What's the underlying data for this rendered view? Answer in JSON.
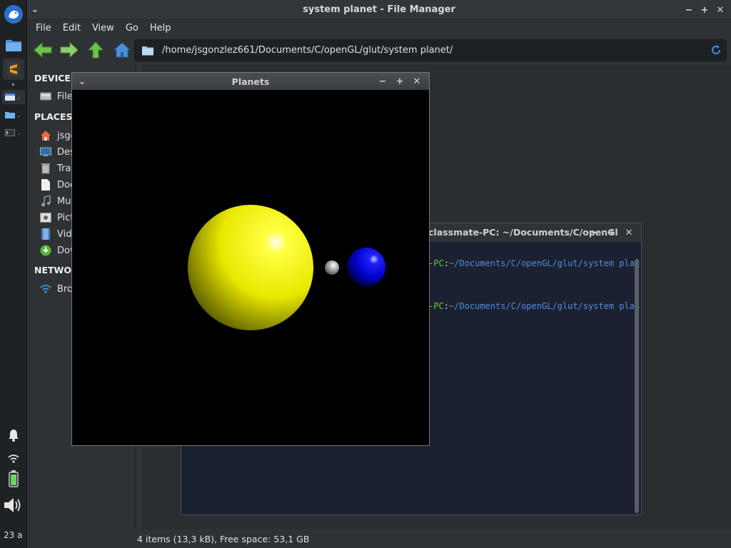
{
  "dock": {
    "clock_text": "23 a",
    "tasks": [
      ".",
      ".",
      "."
    ]
  },
  "file_manager": {
    "title": "system planet - File Manager",
    "menu": [
      "File",
      "Edit",
      "View",
      "Go",
      "Help"
    ],
    "path": "/home/jsgonzlez661/Documents/C/openGL/glut/system planet/",
    "sidebar": {
      "devices_header": "DEVICES",
      "devices": [
        "File"
      ],
      "places_header": "PLACES",
      "places": [
        "jsgo",
        "Des",
        "Tras",
        "Doc",
        "Mus",
        "Pict",
        "Vide",
        "Dow"
      ],
      "network_header": "NETWOR",
      "network": [
        "Bro"
      ]
    },
    "status": "4 items (13,3 kB), Free space: 53,1 GB"
  },
  "terminal": {
    "title": "classmate-PC: ~/Documents/C/openGl",
    "lines": [
      {
        "host": "-PC",
        "sep": ":",
        "path": "~/Documents/C/openGL/glut/system plan"
      },
      {
        "host": "-PC",
        "sep": ":",
        "path": "~/Documents/C/openGL/glut/system plan"
      }
    ]
  },
  "planets_window": {
    "title": "Planets"
  },
  "colors": {
    "sun": "#ffff00",
    "planet": "#0000e0",
    "moon": "#cccccc",
    "accent_green": "#5ecb3e",
    "accent_blue": "#4f8ce0"
  }
}
